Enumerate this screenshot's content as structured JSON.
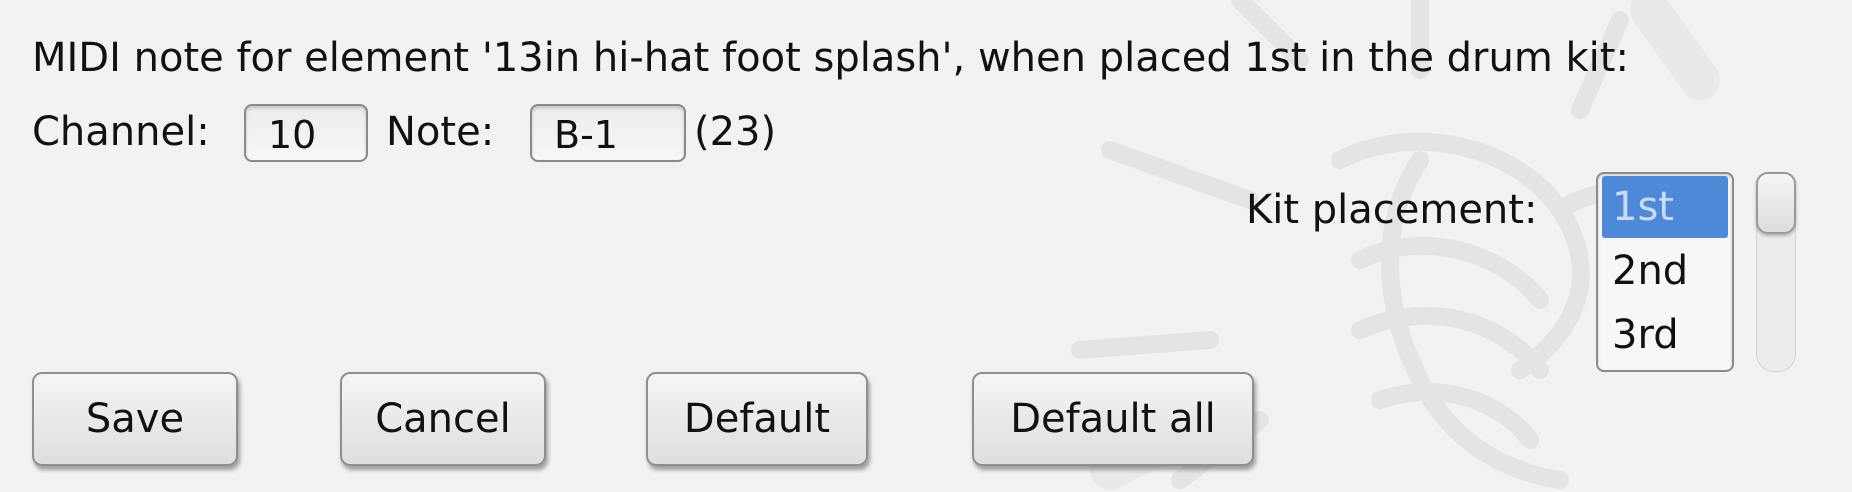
{
  "dialog": {
    "title_line": "MIDI note for element '13in hi-hat foot splash', when placed 1st in the drum kit:",
    "channel_label": "Channel:",
    "channel_value": "10",
    "note_label": "Note:",
    "note_value": "B-1",
    "note_number": "(23)",
    "kit_placement_label": "Kit placement:",
    "kit_placement_options": [
      "1st",
      "2nd",
      "3rd"
    ],
    "kit_placement_selected": "1st"
  },
  "buttons": {
    "save": "Save",
    "cancel": "Cancel",
    "default": "Default",
    "default_all": "Default all"
  },
  "colors": {
    "selection": "#4e88d8",
    "background": "#f2f2f2"
  }
}
